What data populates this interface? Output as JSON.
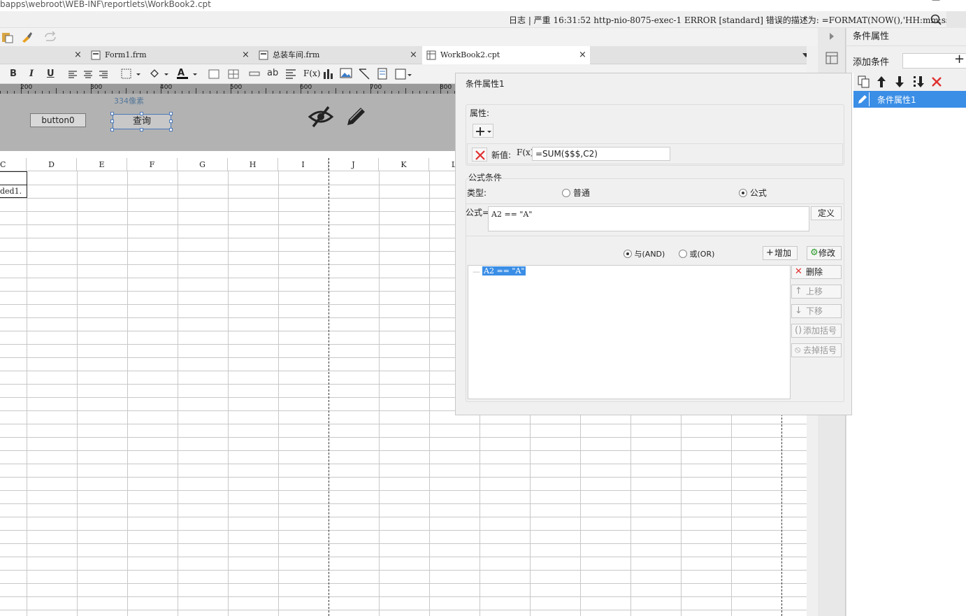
{
  "window": {
    "title_path": "bapps\\webroot\\WEB-INF\\reportlets\\WorkBook2.cpt",
    "minimize_glyph": "—"
  },
  "logbar": {
    "text": "日志 | 严重 16:31:52 http-nio-8075-exec-1 ERROR [standard] 错误的描述为: =FORMAT(NOW(),'HH:mm:ss'"
  },
  "tabs": [
    {
      "label": "Form1.frm",
      "close": "×"
    },
    {
      "label": "总装车间.frm",
      "close": "×"
    },
    {
      "label": "WorkBook2.cpt",
      "close": "×"
    }
  ],
  "format_toolbar": {
    "bold": "B",
    "italic": "I",
    "underline": "U",
    "text_ab": "ab",
    "fx": "F(x)"
  },
  "ruler": {
    "ticks": [
      "200",
      "300",
      "400",
      "500",
      "600",
      "700",
      "800"
    ]
  },
  "form": {
    "button0_label": "button0",
    "query_label": "查询",
    "width_label": "334像素"
  },
  "sheet": {
    "columns": [
      "C",
      "D",
      "E",
      "F",
      "G",
      "H",
      "I",
      "J",
      "K",
      "L"
    ],
    "cell_c2": "ded1."
  },
  "right_panel": {
    "title": "条件属性",
    "add_condition_label": "添加条件",
    "add_glyph": "+",
    "list_items": [
      {
        "label": "条件属性1"
      }
    ]
  },
  "dialog": {
    "title": "条件属性1",
    "properties_section": "属性:",
    "new_value_label": "新值:",
    "new_value_formula": "=SUM($$$,C2)",
    "fx_label": "F(x)",
    "formula_condition_section": "公式条件",
    "type_label": "类型:",
    "type_options": [
      {
        "label": "普通",
        "selected": false
      },
      {
        "label": "公式",
        "selected": true
      }
    ],
    "formula_label": "公式=",
    "formula_value": "A2 == \"A\"",
    "define_button": "定义",
    "logic_and_label": "与(AND)",
    "logic_or_label": "或(OR)",
    "logic_selected": "and",
    "add_button": "增加",
    "modify_button": "修改",
    "condition_items": [
      "A2 == \"A\""
    ],
    "delete_button": "删除",
    "move_up_button": "上移",
    "move_down_button": "下移",
    "add_paren_button": "添加括号",
    "remove_paren_button": "去掉括号"
  }
}
